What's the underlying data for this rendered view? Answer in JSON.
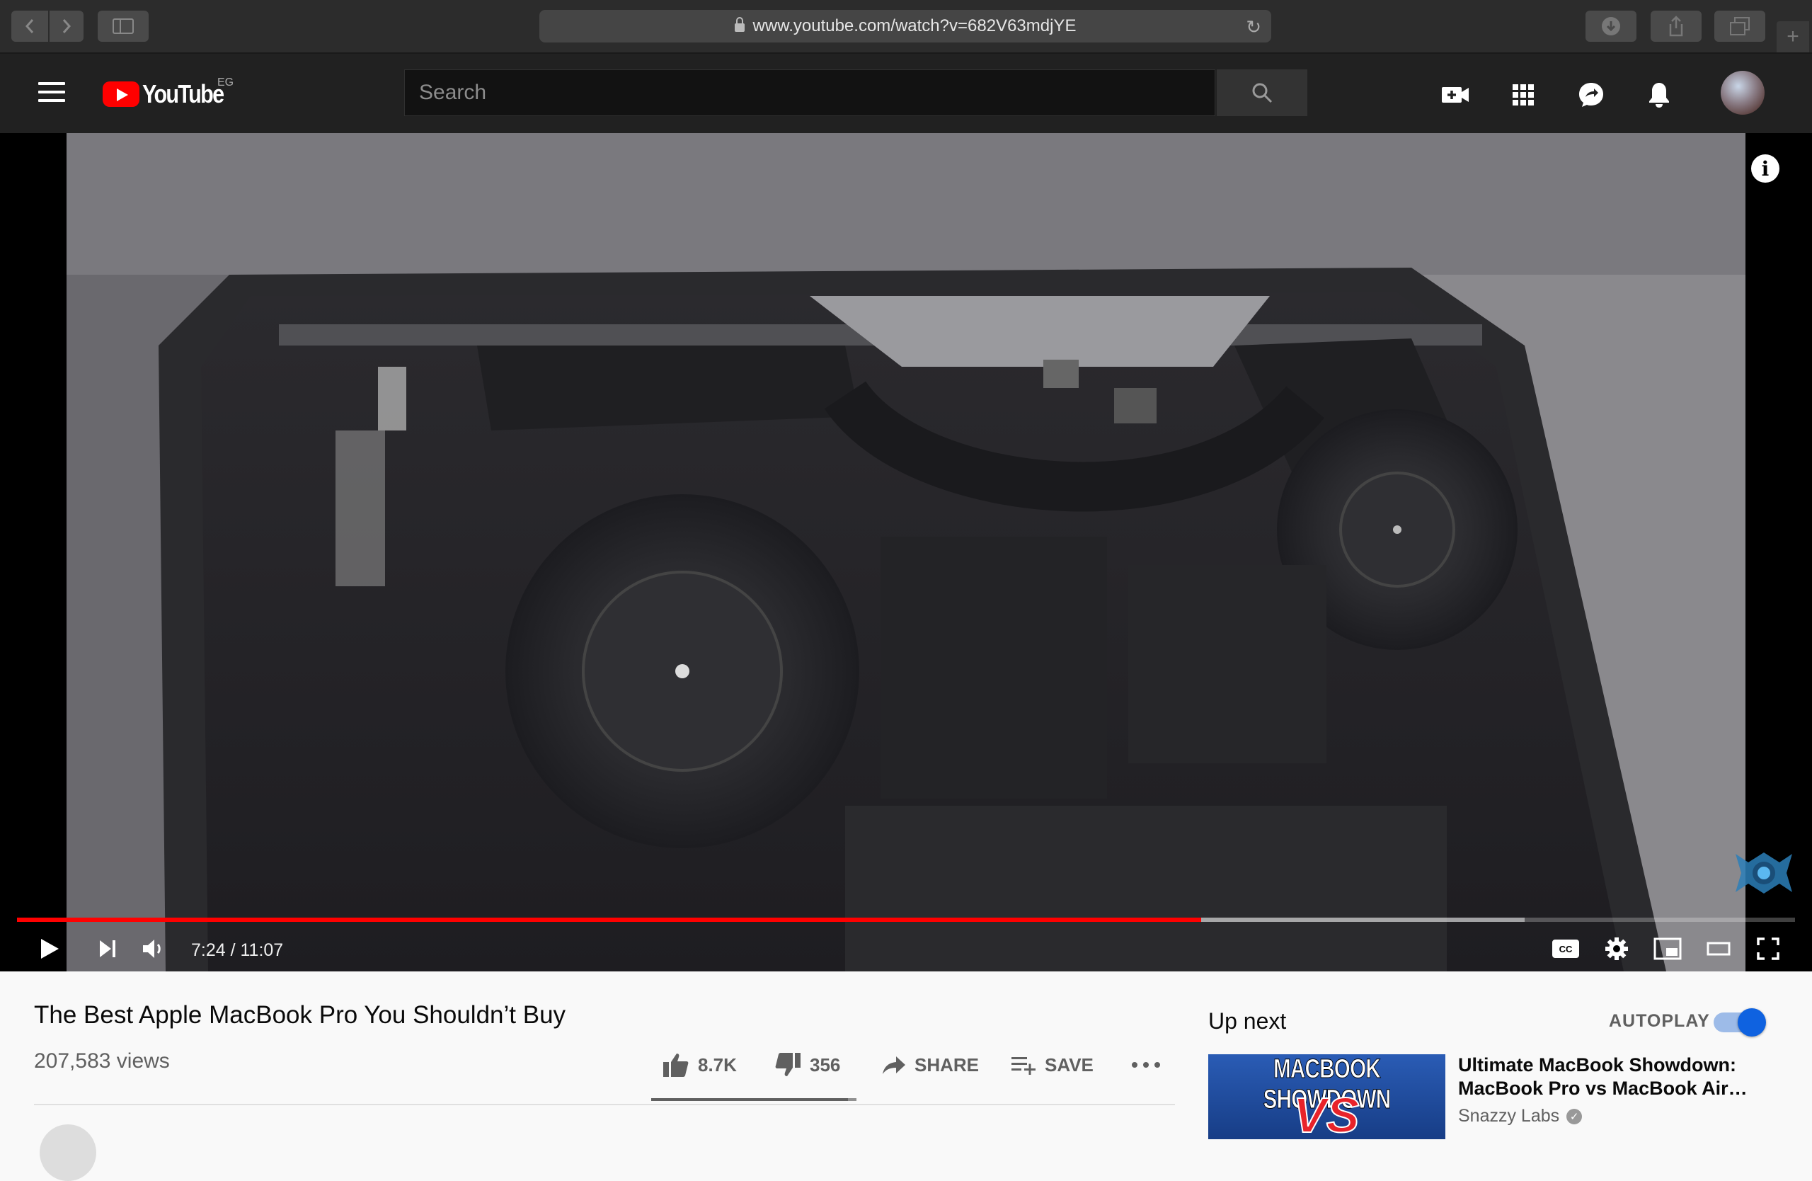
{
  "browser": {
    "url": "www.youtube.com/watch?v=682V63mdjYE"
  },
  "header": {
    "logo_text": "YouTube",
    "country_code": "EG",
    "search_placeholder": "Search"
  },
  "player": {
    "current_time": "7:24",
    "duration": "11:07",
    "time_display": "7:24 / 11:07",
    "played_fraction": 0.666,
    "loaded_fraction": 0.848,
    "info_label": "i",
    "cc_label": "CC"
  },
  "video": {
    "title": "The Best Apple MacBook Pro You Shouldn’t Buy",
    "views": "207,583 views",
    "likes": "8.7K",
    "dislikes": "356",
    "share_label": "SHARE",
    "save_label": "SAVE"
  },
  "sidebar": {
    "up_next_label": "Up next",
    "autoplay_label": "AUTOPLAY",
    "autoplay_on": true,
    "next_video": {
      "thumb_text": "MACBOOK SHOWDOWN",
      "thumb_vs": "VS",
      "title": "Ultimate MacBook Showdown: MacBook Pro vs MacBook Air…",
      "channel": "Snazzy Labs"
    }
  },
  "colors": {
    "progress_played": "#ff0000",
    "toggle_on": "#0f62e0",
    "header_bg": "#212121"
  }
}
